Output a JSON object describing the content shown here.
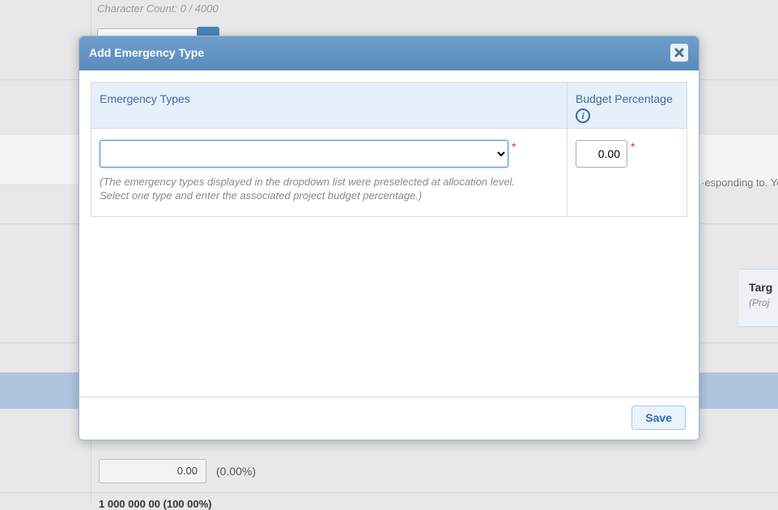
{
  "background": {
    "char_count": "Character Count: 0 / 4000",
    "right_snippet": "·esponding to. Yo",
    "targ_title": "Targ",
    "targ_sub": "(Proj",
    "num_value": "0.00",
    "num_pct": "(0.00%)",
    "bottom_num": "1 000 000 00 (100 00%)"
  },
  "modal": {
    "title": "Add Emergency Type",
    "columns": {
      "emergency_types": "Emergency Types",
      "budget_percentage": "Budget Percentage"
    },
    "dropdown_value": "",
    "hint": "(The emergency types displayed in the dropdown list were preselected at allocation level. Select one type and enter the associated project budget percentage.)",
    "budget_value": "0.00",
    "save_label": "Save"
  }
}
